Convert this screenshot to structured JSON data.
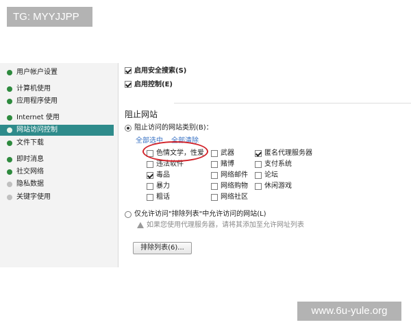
{
  "watermark_top": "TG: MYYJJPP",
  "watermark_bottom": "www.6u-yule.org",
  "sidebar": {
    "items": [
      {
        "label": "用户帐户设置",
        "dot": "green"
      },
      {
        "label": "计算机使用",
        "dot": "green"
      },
      {
        "label": "应用程序使用",
        "dot": "green"
      },
      {
        "label": "Internet 使用",
        "dot": "green"
      },
      {
        "label": "网站访问控制",
        "dot": "green",
        "selected": true
      },
      {
        "label": "文件下载",
        "dot": "green"
      },
      {
        "label": "即时消息",
        "dot": "green"
      },
      {
        "label": "社交网络",
        "dot": "green"
      },
      {
        "label": "隐私数据",
        "dot": "grey"
      },
      {
        "label": "关键字使用",
        "dot": "grey"
      }
    ]
  },
  "main": {
    "options": [
      {
        "label": "启用安全搜索(S)",
        "checked": true
      },
      {
        "label": "启用控制(E)",
        "checked": true
      }
    ],
    "section_title": "阻止网站",
    "radio_block": {
      "label": "阻止访问的网站类别(B)：",
      "selected": true
    },
    "select_all": "全部选中",
    "clear_all": "全部清除",
    "categories": [
      {
        "label": "色情文学，性爱",
        "checked": false
      },
      {
        "label": "武器",
        "checked": false
      },
      {
        "label": "匿名代理服务器",
        "checked": true
      },
      {
        "label": "违法软件",
        "checked": false
      },
      {
        "label": "赌博",
        "checked": false
      },
      {
        "label": "支付系统",
        "checked": false
      },
      {
        "label": "毒品",
        "checked": true
      },
      {
        "label": "网络邮件",
        "checked": false
      },
      {
        "label": "论坛",
        "checked": false
      },
      {
        "label": "暴力",
        "checked": false
      },
      {
        "label": "网络购物",
        "checked": false
      },
      {
        "label": "休闲游戏",
        "checked": false
      },
      {
        "label": "粗话",
        "checked": false
      },
      {
        "label": "网络社区",
        "checked": false
      }
    ],
    "radio_allow": {
      "label": "仅允许访问\"排除列表\"中允许访问的网站(L)",
      "selected": false
    },
    "hint": "如果您使用代理服务器，请将其添加至允许网址列表",
    "exclude_button": "排除列表(6)..."
  }
}
